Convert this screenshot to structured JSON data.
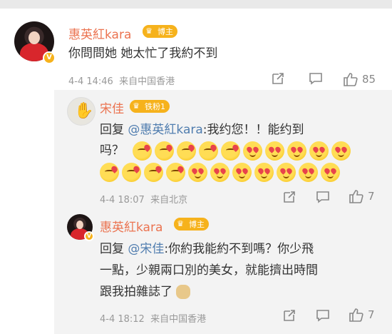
{
  "comment_main": {
    "author": "惠英紅kara",
    "badge": "博主",
    "text": "你問問她  她太忙了我約不到",
    "time": "4-4 14:46",
    "source": "来自中国香港",
    "likes": "85"
  },
  "reply_1": {
    "author": "宋佳",
    "badge": "铁粉1",
    "prefix": "回复 ",
    "mention": "@惠英紅kara",
    "text_line1": ":我约您！！能约到",
    "text_line2": "吗？",
    "emoji_row1": [
      "kiss",
      "kiss",
      "kiss",
      "kiss",
      "kiss",
      "heart",
      "heart",
      "heart",
      "heart",
      "heart"
    ],
    "emoji_row2": [
      "kiss",
      "kiss",
      "kiss",
      "kiss",
      "heart",
      "heart",
      "heart",
      "heart",
      "heart",
      "heart",
      "heart"
    ],
    "time": "4-4 18:07",
    "source": "来自北京",
    "likes": "7"
  },
  "reply_2": {
    "author": "惠英紅kara",
    "badge": "博主",
    "prefix": "回复 ",
    "mention": "@宋佳",
    "text_line1": ":你約我能約不到嗎？你少飛",
    "text_line2": "一點，少親兩口別的美女，就能擠出時間",
    "text_line3": "跟我拍雜誌了",
    "time": "4-4 18:12",
    "source": "来自中国香港",
    "likes": "7"
  },
  "colors": {
    "name": "#eb7350",
    "mention": "#507daf",
    "meta": "#999999",
    "badge": "#f6b21c"
  }
}
